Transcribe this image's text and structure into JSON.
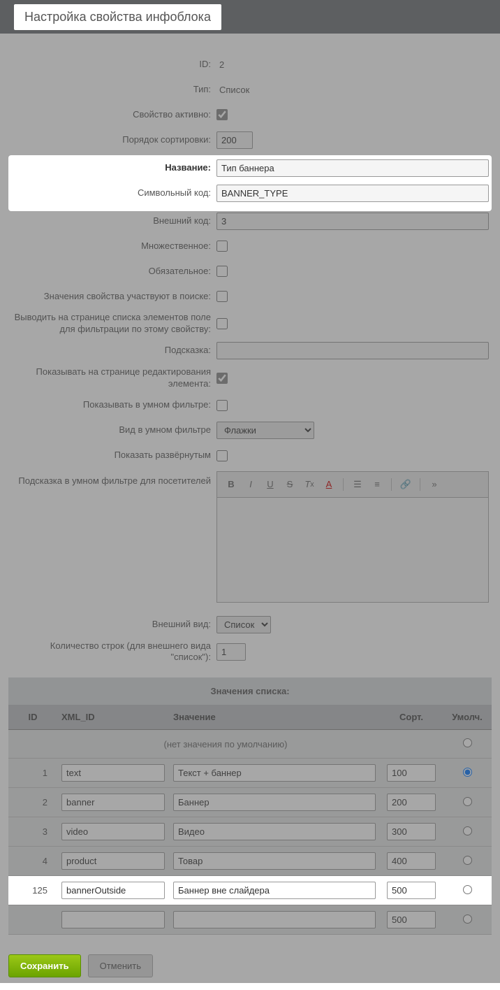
{
  "title": "Настройка свойства инфоблока",
  "fields": {
    "id_label": "ID:",
    "id_value": "2",
    "type_label": "Тип:",
    "type_value": "Список",
    "active_label": "Свойство активно:",
    "sort_label": "Порядок сортировки:",
    "sort_value": "200",
    "name_label": "Название:",
    "name_value": "Тип баннера",
    "code_label": "Символьный код:",
    "code_value": "BANNER_TYPE",
    "xml_id_label": "Внешний код:",
    "xml_id_value": "3",
    "multiple_label": "Множественное:",
    "required_label": "Обязательное:",
    "searchable_label": "Значения свойства участвуют в поиске:",
    "filtrable_label": "Выводить на странице списка элементов поле для фильтрации по этому свойству:",
    "hint_label": "Подсказка:",
    "show_edit_label": "Показывать на странице редактирования элемента:",
    "smart_filter_label": "Показывать в умном фильтре:",
    "smart_filter_view_label": "Вид в умном фильтре",
    "smart_filter_view_value": "Флажки",
    "expanded_label": "Показать развёрнутым",
    "filter_hint_label": "Подсказка в умном фильтре для посетителей",
    "appearance_label": "Внешний вид:",
    "appearance_value": "Список",
    "rows_label": "Количество строк (для внешнего вида \"список\"):",
    "rows_value": "1"
  },
  "list_values_header": "Значения списка:",
  "table": {
    "headers": {
      "id": "ID",
      "xml_id": "XML_ID",
      "value": "Значение",
      "sort": "Сорт.",
      "default": "Умолч."
    },
    "no_default": "(нет значения по умолчанию)",
    "rows": [
      {
        "id": "1",
        "xml_id": "text",
        "value": "Текст + баннер",
        "sort": "100",
        "default": true
      },
      {
        "id": "2",
        "xml_id": "banner",
        "value": "Баннер",
        "sort": "200",
        "default": false
      },
      {
        "id": "3",
        "xml_id": "video",
        "value": "Видео",
        "sort": "300",
        "default": false
      },
      {
        "id": "4",
        "xml_id": "product",
        "value": "Товар",
        "sort": "400",
        "default": false
      },
      {
        "id": "125",
        "xml_id": "bannerOutside",
        "value": "Баннер вне слайдера",
        "sort": "500",
        "default": false,
        "highlight": true
      },
      {
        "id": "",
        "xml_id": "",
        "value": "",
        "sort": "500",
        "default": false
      }
    ]
  },
  "buttons": {
    "save": "Сохранить",
    "cancel": "Отменить"
  }
}
